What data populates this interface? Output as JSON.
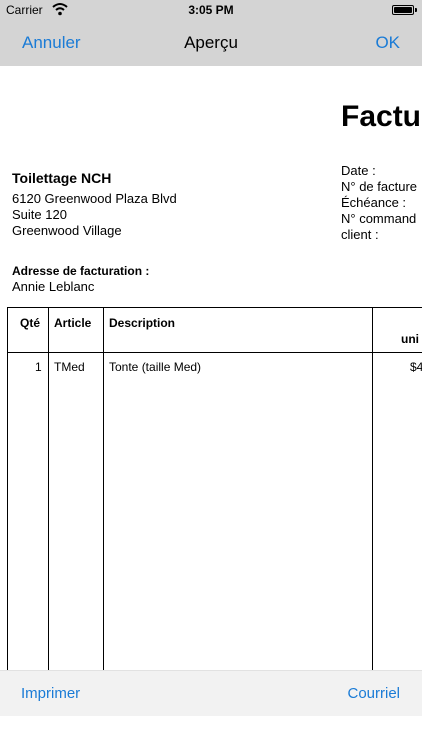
{
  "status_bar": {
    "carrier": "Carrier",
    "time": "3:05 PM",
    "icons": [
      "wifi-icon",
      "battery-icon"
    ]
  },
  "nav": {
    "left_label": "Annuler",
    "title": "Aperçu",
    "right_label": "OK"
  },
  "invoice": {
    "title": "Factu",
    "company": {
      "name": "Toilettage NCH",
      "address1": "6120 Greenwood Plaza Blvd",
      "address2": "Suite 120",
      "city": "Greenwood Village"
    },
    "meta_labels": [
      "Date :",
      "N° de facture",
      "Échéance :",
      "N° command",
      "client :"
    ],
    "billing": {
      "label": "Adresse de facturation :",
      "name": "Annie Leblanc"
    },
    "table": {
      "headers": {
        "qty": "Qté",
        "article": "Article",
        "description": "Description",
        "unit_partial": "uni"
      },
      "rows": [
        {
          "qty": "1",
          "article": "TMed",
          "description": "Tonte (taille Med)",
          "price_partial": "$4"
        }
      ]
    }
  },
  "toolbar": {
    "print_label": "Imprimer",
    "mail_label": "Courriel"
  },
  "colors": {
    "accent": "#1a7bd6",
    "bar_bg": "#d4d4d4",
    "toolbar_bg": "#f2f2f2"
  }
}
